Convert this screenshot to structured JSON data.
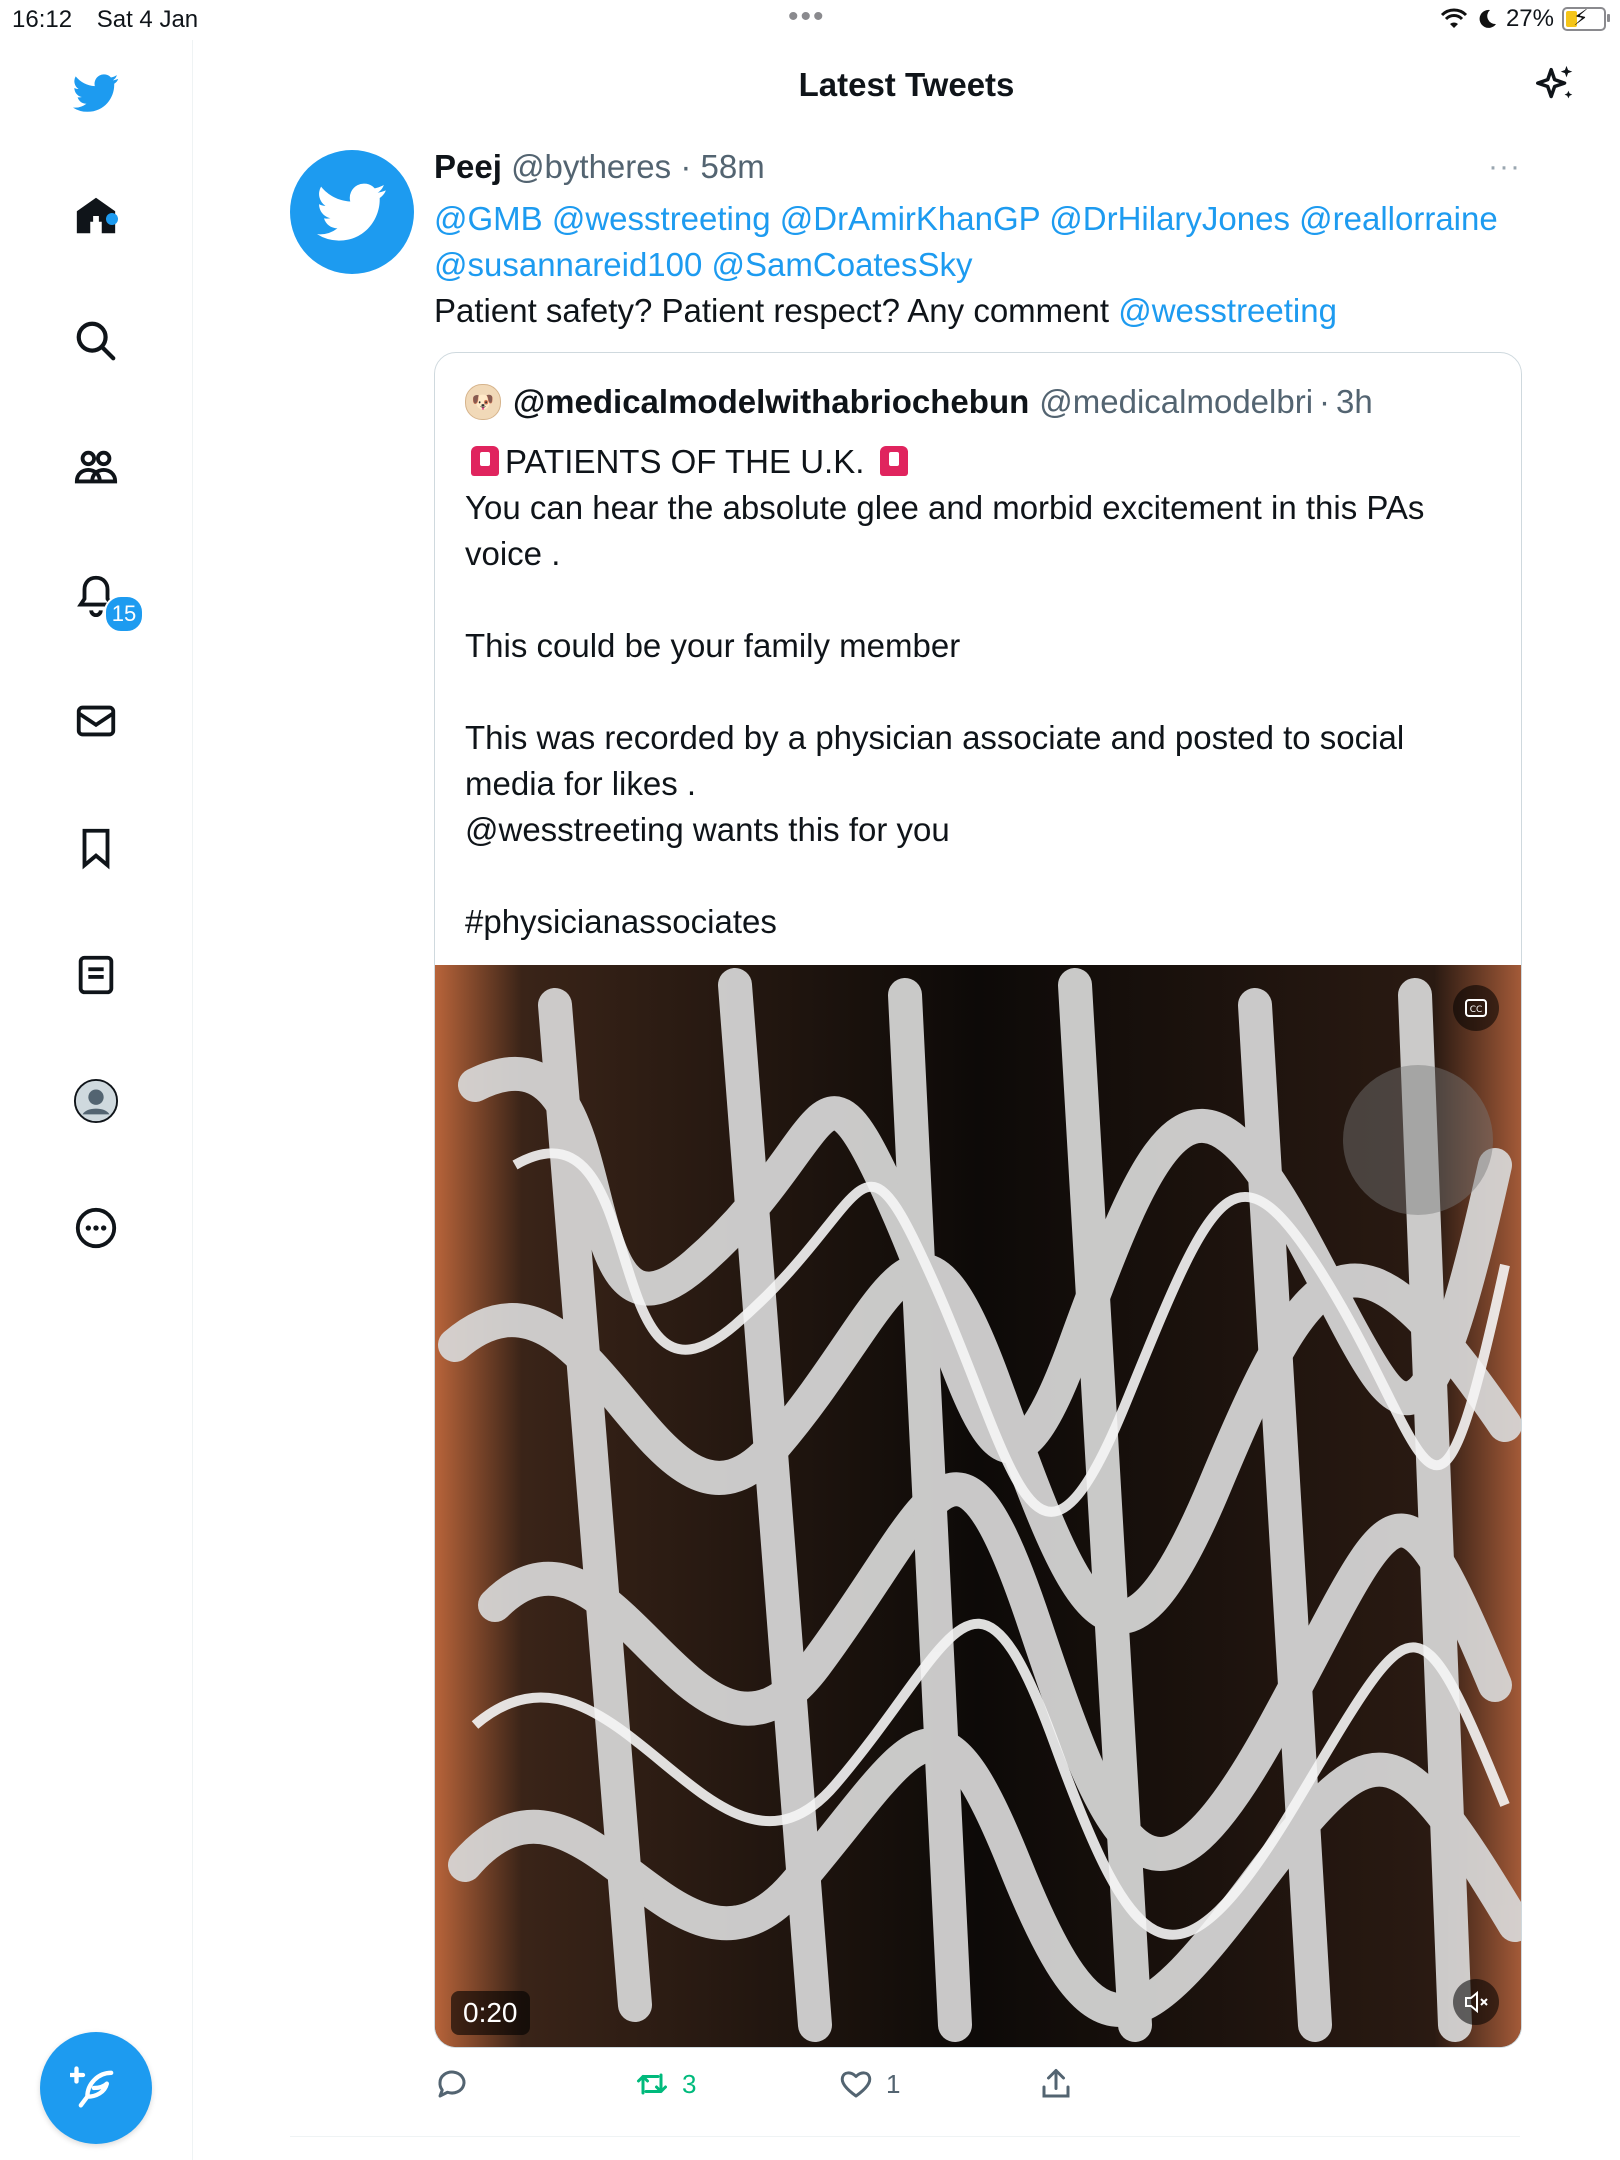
{
  "status_bar": {
    "time": "16:12",
    "date": "Sat 4 Jan",
    "battery": "27%"
  },
  "header": {
    "title": "Latest Tweets"
  },
  "sidebar": {
    "items": [
      {
        "name": "home"
      },
      {
        "name": "search"
      },
      {
        "name": "communities"
      },
      {
        "name": "notifications",
        "badge": "15"
      },
      {
        "name": "messages"
      },
      {
        "name": "bookmarks"
      },
      {
        "name": "lists"
      },
      {
        "name": "profile"
      },
      {
        "name": "more"
      }
    ],
    "compose": "compose-tweet"
  },
  "tweet": {
    "name": "Peej",
    "handle": "@bytheres",
    "dot": "·",
    "time": "58m",
    "more": "···",
    "mentions": [
      "@GMB",
      "@wesstreeting",
      "@DrAmirKhanGP",
      "@DrHilaryJones",
      "@reallorraine",
      "@susannareid100",
      "@SamCoatesSky"
    ],
    "text_prefix": "Patient safety? Patient respect? Any comment",
    "text_mention": "@wesstreeting",
    "quote": {
      "name": "@medicalmodelwithabriochebun",
      "handle": "@medicalmodelbri",
      "dot": "·",
      "time": "3h",
      "headline": "PATIENTS OF THE U.K.",
      "text": "You can hear the absolute glee and morbid excitement in this PAs voice .\n\nThis could be your family member\n\nThis was recorded by a physician associate and posted to social media for likes .\n@wesstreeting wants this for you\n\n#physicianassociates",
      "video_duration": "0:20",
      "cc_label": "CC"
    },
    "actions": {
      "replies": "",
      "retweets": "3",
      "likes": "1"
    }
  },
  "colors": {
    "accent": "#1d9bf0",
    "retweet": "#00ba7c",
    "secondary": "#536471"
  }
}
